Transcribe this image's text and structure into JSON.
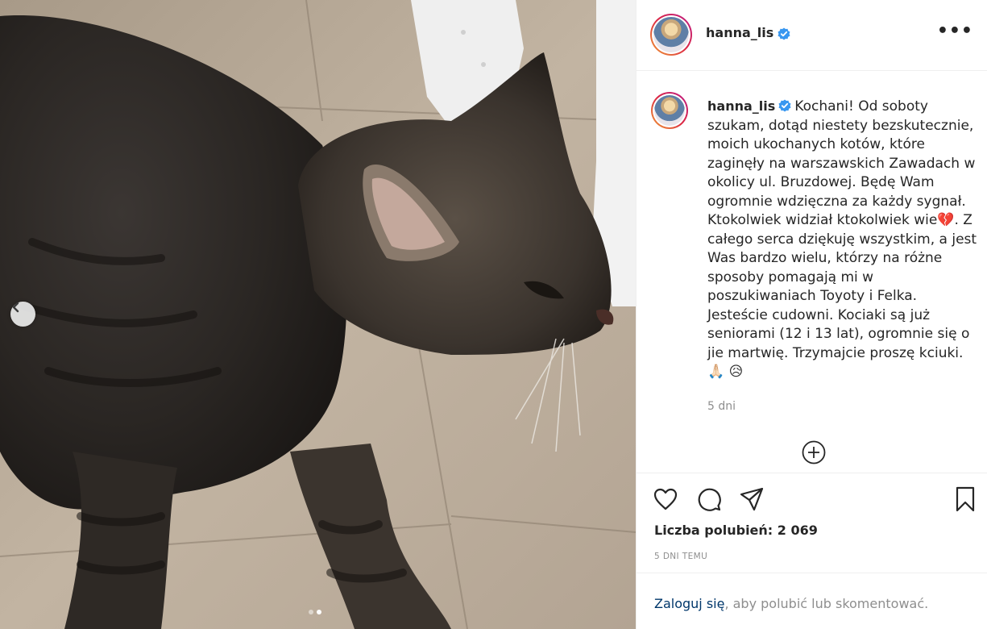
{
  "post": {
    "username": "hanna_lis",
    "caption": "Kochani! Od soboty szukam, dotąd niestety bezskutecznie, moich ukochanych kotów, które zaginęły na warszawskich Zawadach w okolicy ul. Bruzdowej. Będę Wam ogromnie wdzięczna za każdy sygnał. Ktokolwiek widział ktokolwiek wie💔. Z całego serca dziękuję wszystkim, a jest Was bardzo wielu, którzy na różne sposoby pomagają mi w poszukiwaniach Toyoty i Felka. Jesteście cudowni. Kociaki są już seniorami (12 i 13 lat), ogromnie się o jie martwię. Trzymajcie proszę kciuki. 🙏🏻 😥",
    "caption_time": "5 dni",
    "likes": "Liczba polubień: 2 069",
    "time_ago": "5 DNI TEMU"
  },
  "login": {
    "link": "Zaloguj się",
    "rest": ", aby polubić lub skomentować."
  },
  "carousel": {
    "slides": 2,
    "active": 2
  },
  "icons": {
    "more": "more-options-icon",
    "verified": "verified-badge-icon",
    "prev": "chevron-left-icon",
    "like": "heart-icon",
    "comment": "comment-icon",
    "share": "share-icon",
    "save": "bookmark-icon",
    "load_more": "plus-circle-icon"
  },
  "colors": {
    "verified": "#3897f0",
    "link": "#00376b",
    "muted": "#8e8e8e"
  }
}
